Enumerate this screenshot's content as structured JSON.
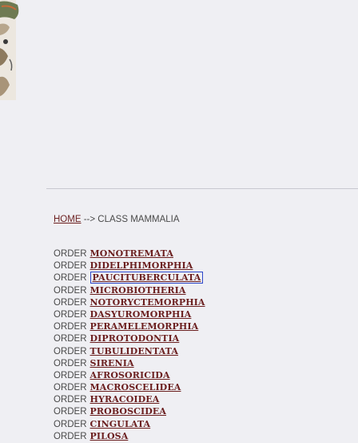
{
  "breadcrumb": {
    "home": "HOME",
    "separator": "-->",
    "current": "CLASS MAMMALIA"
  },
  "orders": [
    {
      "prefix": "ORDER",
      "name": "MONOTREMATA"
    },
    {
      "prefix": "ORDER",
      "name": "DIDELPHIMORPHIA"
    },
    {
      "prefix": "ORDER",
      "name": "PAUCITUBERCULATA",
      "selected": true
    },
    {
      "prefix": "ORDER",
      "name": "MICROBIOTHERIA"
    },
    {
      "prefix": "ORDER",
      "name": "NOTORYCTEMORPHIA"
    },
    {
      "prefix": "ORDER",
      "name": "DASYUROMORPHIA"
    },
    {
      "prefix": "ORDER",
      "name": "PERAMELEMORPHIA"
    },
    {
      "prefix": "ORDER",
      "name": "DIPROTODONTIA"
    },
    {
      "prefix": "ORDER",
      "name": "TUBULIDENTATA"
    },
    {
      "prefix": "ORDER",
      "name": "SIRENIA"
    },
    {
      "prefix": "ORDER",
      "name": "AFROSORICIDA"
    },
    {
      "prefix": "ORDER",
      "name": "MACROSCELIDEA"
    },
    {
      "prefix": "ORDER",
      "name": "HYRACOIDEA"
    },
    {
      "prefix": "ORDER",
      "name": "PROBOSCIDEA"
    },
    {
      "prefix": "ORDER",
      "name": "CINGULATA"
    },
    {
      "prefix": "ORDER",
      "name": "PILOSA"
    }
  ],
  "colors": {
    "background": "#efeff3",
    "link": "#6b1f1f",
    "focus_outline": "#2c46c8"
  }
}
